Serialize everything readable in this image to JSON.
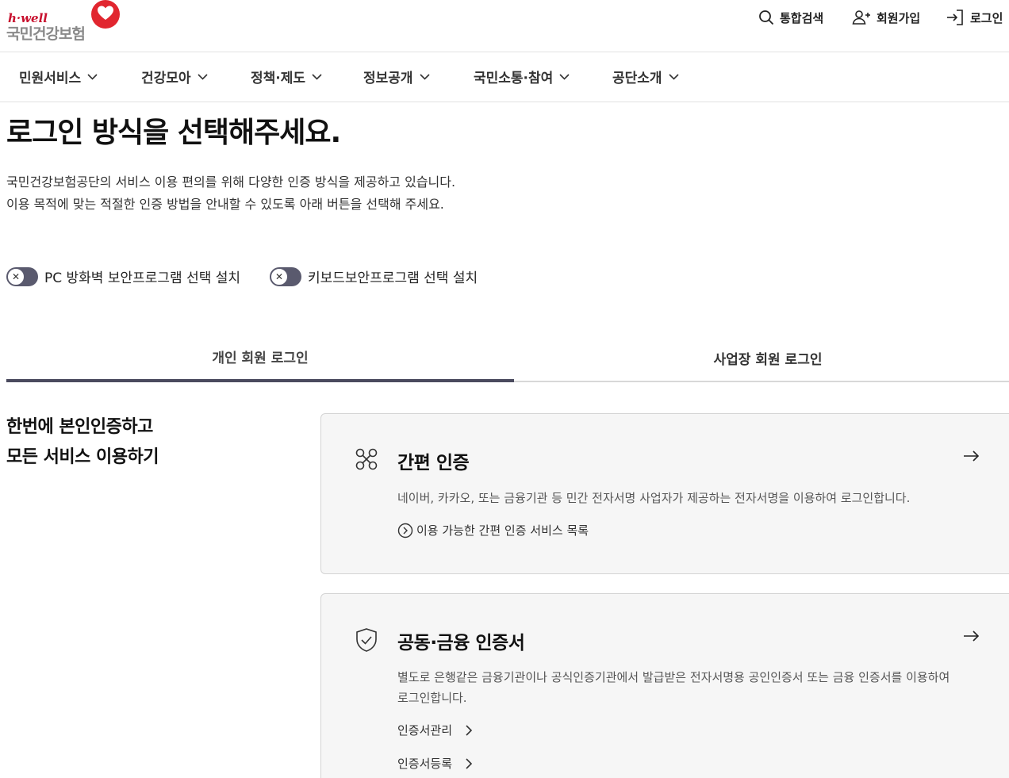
{
  "header": {
    "logo_brand": "h·well",
    "logo_name": "국민건강보험",
    "util": {
      "search": "통합검색",
      "signup": "회원가입",
      "login": "로그인"
    }
  },
  "gnb": {
    "items": [
      "민원서비스",
      "건강모아",
      "정책·제도",
      "정보공개",
      "국민소통·참여",
      "공단소개"
    ]
  },
  "main": {
    "title": "로그인 방식을 선택해주세요.",
    "desc_line1": "국민건강보험공단의 서비스 이용 편의를 위해 다양한 인증 방식을 제공하고 있습니다.",
    "desc_line2": "이용 목적에 맞는 적절한 인증 방법을 안내할 수 있도록 아래 버튼을 선택해 주세요.",
    "toggles": [
      {
        "label": "PC 방화벽 보안프로그램 선택 설치",
        "state": "off"
      },
      {
        "label": "키보드보안프로그램 선택 설치",
        "state": "off"
      }
    ],
    "tabs": [
      {
        "label": "개인 회원 로그인",
        "active": true
      },
      {
        "label": "사업장 회원 로그인",
        "active": false
      }
    ],
    "side_heading_line1": "한번에 본인인증하고",
    "side_heading_line2": "모든 서비스 이용하기",
    "cards": [
      {
        "icon": "simple-auth-icon",
        "title": "간편 인증",
        "desc": "네이버, 카카오, 또는 금융기관 등 민간 전자서명 사업자가 제공하는 전자서명을 이용하여 로그인합니다.",
        "link": "이용 가능한 간편 인증 서비스 목록"
      },
      {
        "icon": "shield-check-icon",
        "title": "공동·금융 인증서",
        "desc": "별도로 은행같은 금융기관이나 공식인증기관에서 발급받은 전자서명용 공인인증서 또는 금융 인증서를 이용하여 로그인합니다.",
        "links": [
          "인증서관리",
          "인증서등록"
        ]
      }
    ]
  },
  "colors": {
    "brand_red": "#e1262f",
    "tab_active": "#4a4a5e",
    "card_bg": "#f6f6f6"
  }
}
